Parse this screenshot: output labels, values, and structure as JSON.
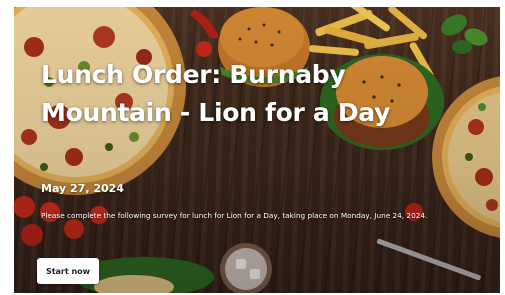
{
  "hero": {
    "title": "Lunch Order: Burnaby Mountain - Lion for a Day",
    "date": "May 27, 2024",
    "description": "Please complete the following survey for lunch for Lion for a Day, taking place on Monday, June 24, 2024.",
    "start_button_label": "Start now",
    "background_image": "food-table-image"
  },
  "colors": {
    "wood": "#3e281b",
    "title_text": "#ffffff",
    "button_bg": "#ffffff",
    "button_text": "#222222"
  }
}
